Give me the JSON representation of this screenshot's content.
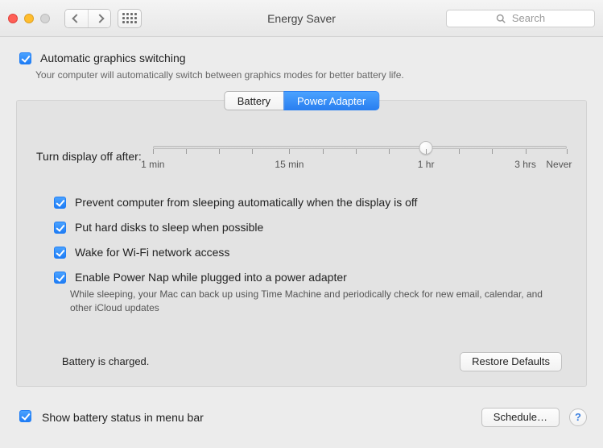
{
  "window": {
    "title": "Energy Saver"
  },
  "search": {
    "placeholder": "Search"
  },
  "auto_graphics": {
    "label": "Automatic graphics switching",
    "checked": true,
    "desc": "Your computer will automatically switch between graphics modes for better battery life."
  },
  "tabs": {
    "battery": "Battery",
    "power_adapter": "Power Adapter",
    "active": "power_adapter"
  },
  "slider": {
    "label": "Turn display off after:",
    "min_pct": 0,
    "value_pct": 66,
    "labels": {
      "min1": "1 min",
      "min15": "15 min",
      "hr1": "1 hr",
      "hr3": "3 hrs",
      "never": "Never"
    }
  },
  "options": {
    "prevent_sleep": {
      "label": "Prevent computer from sleeping automatically when the display is off",
      "checked": true
    },
    "hard_disks": {
      "label": "Put hard disks to sleep when possible",
      "checked": true
    },
    "wake_wifi": {
      "label": "Wake for Wi-Fi network access",
      "checked": true
    },
    "power_nap": {
      "label": "Enable Power Nap while plugged into a power adapter",
      "checked": true,
      "desc": "While sleeping, your Mac can back up using Time Machine and periodically check for new email, calendar, and other iCloud updates"
    }
  },
  "status": "Battery is charged.",
  "buttons": {
    "restore_defaults": "Restore Defaults",
    "schedule": "Schedule…"
  },
  "menubar_status": {
    "label": "Show battery status in menu bar",
    "checked": true
  },
  "help": "?"
}
